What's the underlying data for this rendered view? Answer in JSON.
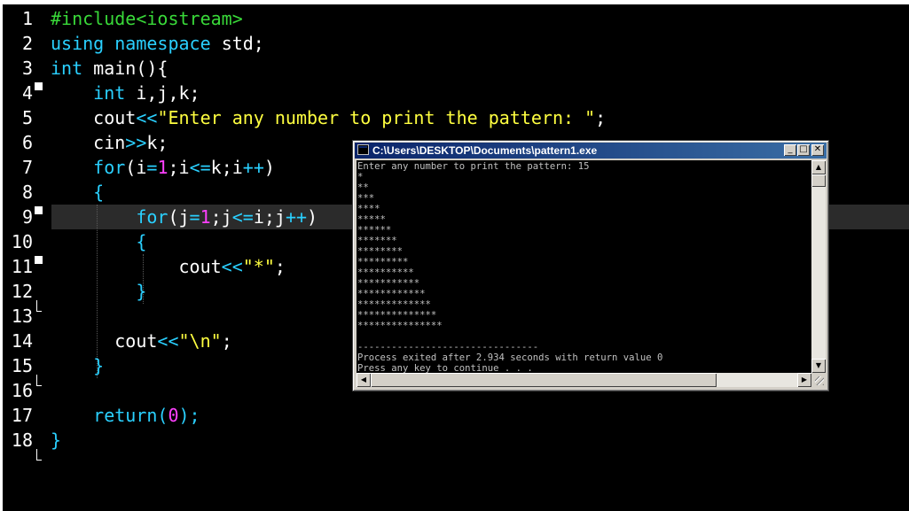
{
  "editor": {
    "lines": [
      {
        "n": "1"
      },
      {
        "n": "2"
      },
      {
        "n": "3"
      },
      {
        "n": "4"
      },
      {
        "n": "5"
      },
      {
        "n": "6"
      },
      {
        "n": "7"
      },
      {
        "n": "8"
      },
      {
        "n": "9"
      },
      {
        "n": "10"
      },
      {
        "n": "11"
      },
      {
        "n": "12"
      },
      {
        "n": "13"
      },
      {
        "n": "14"
      },
      {
        "n": "15"
      },
      {
        "n": "16"
      },
      {
        "n": "17"
      },
      {
        "n": "18"
      }
    ],
    "code": {
      "l1": "#include<iostream>",
      "l2a": "using",
      "l2b": "namespace",
      "l2c": "std;",
      "l3a": "int",
      "l3b": "main(){",
      "l4a": "int",
      "l4b": "i,j,k;",
      "l5a": "cout",
      "l5b": "<<",
      "l5c": "\"Enter any number to print the pattern: \"",
      "l5d": ";",
      "l6a": "cin",
      "l6b": ">>",
      "l6c": "k;",
      "l7a": "for",
      "l7b": "(i",
      "l7c": "=",
      "l7d": "1",
      "l7e": ";i",
      "l7f": "<=",
      "l7g": "k;i",
      "l7h": "++",
      "l7i": ")",
      "l8": "{",
      "l9a": "for",
      "l9b": "(j",
      "l9c": "=",
      "l9d": "1",
      "l9e": ";j",
      "l9f": "<=",
      "l9g": "i;j",
      "l9h": "++",
      "l9i": ")",
      "l10": "{",
      "l11a": "cout",
      "l11b": "<<",
      "l11c": "\"*\"",
      "l11d": ";",
      "l12": "}",
      "l14a": "cout",
      "l14b": "<<",
      "l14c": "\"\\n\"",
      "l14d": ";",
      "l15": "}",
      "l17a": "return",
      "l17b": "(",
      "l17c": "0",
      "l17d": ");",
      "l18": "}"
    }
  },
  "console": {
    "title": "C:\\Users\\DESKTOP\\Documents\\pattern1.exe",
    "minimize": "_",
    "maximize": "□",
    "close": "✕",
    "output": [
      "Enter any number to print the pattern: 15",
      "*",
      "**",
      "***",
      "****",
      "*****",
      "******",
      "*******",
      "********",
      "*********",
      "**********",
      "***********",
      "************",
      "*************",
      "**************",
      "***************",
      "",
      "--------------------------------",
      "Process exited after 2.934 seconds with return value 0",
      "Press any key to continue . . . _"
    ]
  },
  "colors": {
    "editor_bg": "#000000",
    "keyword": "#2ad0ff",
    "preprocessor": "#39d939",
    "string": "#ffff40",
    "number": "#ff40ff",
    "titlebar": "#0a246a"
  }
}
